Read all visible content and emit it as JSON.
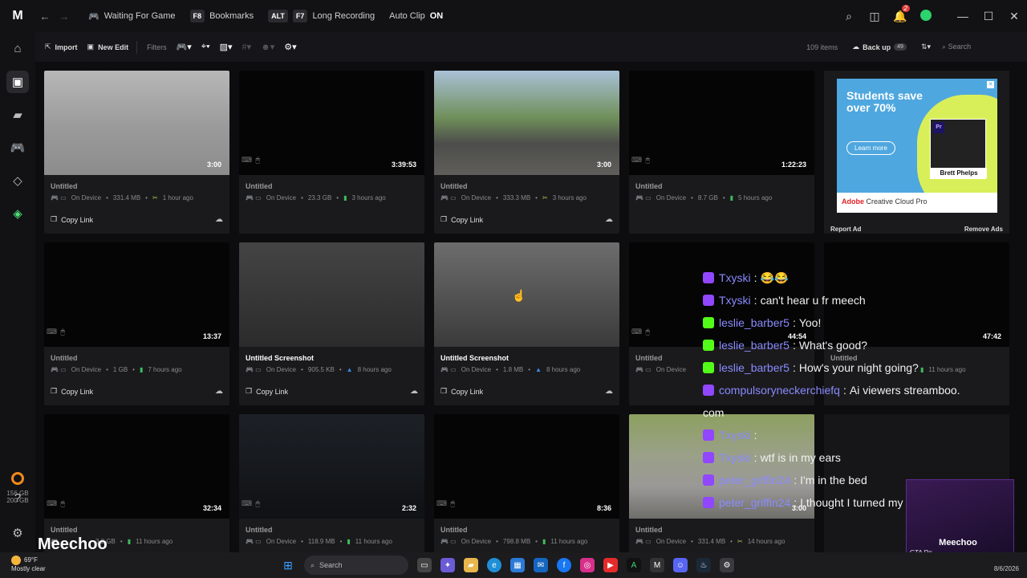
{
  "titlebar": {
    "items": [
      {
        "key": "",
        "label": "Waiting For Game"
      },
      {
        "key": "F8",
        "label": "Bookmarks"
      },
      {
        "key": "ALT",
        "label": ""
      },
      {
        "key": "F7",
        "label": "Long Recording"
      }
    ],
    "auto_clip_label": "Auto Clip",
    "auto_clip_state": "ON",
    "notification_count": "2"
  },
  "toolbar": {
    "import": "Import",
    "new_edit": "New Edit",
    "filters": "Filters",
    "item_count": "109 items",
    "backup": "Back up",
    "backup_count": "49",
    "search_placeholder": "Search"
  },
  "sidebar": {
    "storage_used": "156 GB",
    "storage_total": "200 GB"
  },
  "cards": [
    {
      "title": "Untitled",
      "device": "On Device",
      "size": "331.4 MB",
      "time": "1 hour ago",
      "duration": "3:00",
      "copy": "Copy Link"
    },
    {
      "title": "Untitled",
      "device": "On Device",
      "size": "23.3 GB",
      "time": "3 hours ago",
      "duration": "3:39:53",
      "copy": ""
    },
    {
      "title": "Untitled",
      "device": "On Device",
      "size": "333.3 MB",
      "time": "3 hours ago",
      "duration": "3:00",
      "copy": "Copy Link"
    },
    {
      "title": "Untitled",
      "device": "On Device",
      "size": "8.7 GB",
      "time": "5 hours ago",
      "duration": "1:22:23",
      "copy": ""
    },
    {
      "title": "Untitled",
      "device": "On Device",
      "size": "1 GB",
      "time": "7 hours ago",
      "duration": "13:37",
      "copy": "Copy Link"
    },
    {
      "title": "Untitled Screenshot",
      "device": "On Device",
      "size": "905.5 KB",
      "time": "8 hours ago",
      "duration": "",
      "copy": "Copy Link"
    },
    {
      "title": "Untitled Screenshot",
      "device": "On Device",
      "size": "1.8 MB",
      "time": "8 hours ago",
      "duration": "",
      "copy": "Copy Link"
    },
    {
      "title": "Untitled",
      "device": "On Device",
      "size": "",
      "time": "",
      "duration": "44:54",
      "copy": ""
    },
    {
      "title": "Untitled",
      "device": "",
      "size": "",
      "time": "11 hours ago",
      "duration": "47:42",
      "copy": ""
    },
    {
      "title": "Untitled",
      "device": "",
      "size": "3.2 GB",
      "time": "11 hours ago",
      "duration": "32:34",
      "copy": ""
    },
    {
      "title": "Untitled",
      "device": "On Device",
      "size": "118.9 MB",
      "time": "11 hours ago",
      "duration": "2:32",
      "copy": ""
    },
    {
      "title": "Untitled",
      "device": "On Device",
      "size": "798.8 MB",
      "time": "11 hours ago",
      "duration": "8:36",
      "copy": ""
    },
    {
      "title": "Untitled",
      "device": "On Device",
      "size": "331.4 MB",
      "time": "14 hours ago",
      "duration": "3:00",
      "copy": ""
    }
  ],
  "ad": {
    "headline": "Students save over 70%",
    "cta": "Learn more",
    "person_name": "Brett Phelps",
    "brand": "Adobe",
    "product": "Creative Cloud Pro",
    "report": "Report Ad",
    "remove": "Remove Ads",
    "pr": "Pr"
  },
  "chat": [
    {
      "platform": "twitch",
      "user": "Txyski",
      "msg": "😂😂"
    },
    {
      "platform": "twitch",
      "user": "Txyski",
      "msg": "can't hear u fr meech"
    },
    {
      "platform": "kick",
      "user": "leslie_barber5",
      "msg": "Yoo!"
    },
    {
      "platform": "kick",
      "user": "leslie_barber5",
      "msg": "What's good?"
    },
    {
      "platform": "kick",
      "user": "leslie_barber5",
      "msg": "How's your night going?"
    },
    {
      "platform": "twitch",
      "user": "compulsoryneckerchiefq",
      "msg": "Ai viewers streamboo."
    },
    {
      "platform": "",
      "user": "",
      "msg": "com"
    },
    {
      "platform": "twitch",
      "user": "Txyski",
      "msg": ""
    },
    {
      "platform": "twitch",
      "user": "Txyski",
      "msg": "wtf is in my ears"
    },
    {
      "platform": "twitch",
      "user": "peter_griffin24",
      "msg": "I'm in the bed"
    },
    {
      "platform": "twitch",
      "user": "peter_griffin24",
      "msg": "I thought I turned my shut off"
    }
  ],
  "stream": {
    "name": "Meechoo",
    "cam_name": "Meechoo",
    "cam_sub": "GTA Rp"
  },
  "taskbar": {
    "temp": "69°F",
    "condition": "Mostly clear",
    "search": "Search",
    "date": "8/6/2026"
  }
}
